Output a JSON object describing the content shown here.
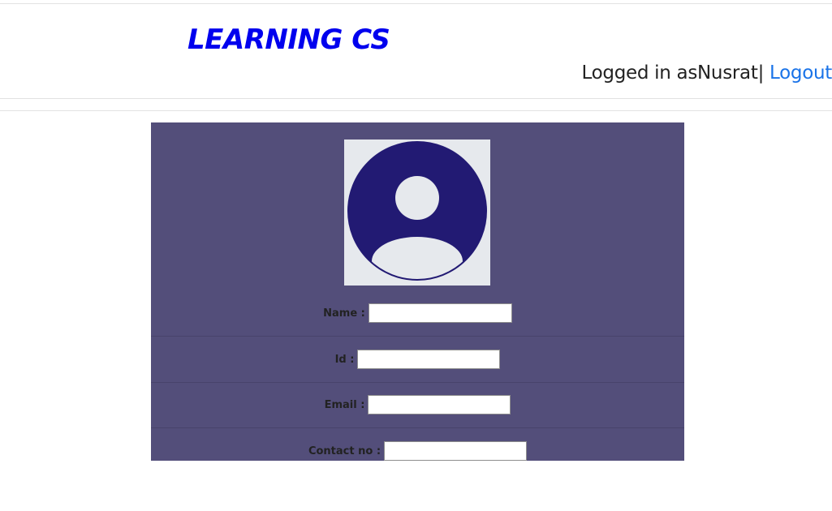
{
  "header": {
    "brand": "LEARNING CS",
    "logged_in_prefix": "Logged in as",
    "username": "Nusrat",
    "separator": "|",
    "logout_label": "Logout"
  },
  "profile": {
    "avatar_icon": "user-avatar-icon",
    "fields": [
      {
        "label": "Name :",
        "value": "",
        "placeholder": ""
      },
      {
        "label": "Id :",
        "value": "",
        "placeholder": ""
      },
      {
        "label": "Email :",
        "value": "",
        "placeholder": ""
      },
      {
        "label": "Contact no :",
        "value": "",
        "placeholder": ""
      }
    ]
  },
  "colors": {
    "brand": "#0000ee",
    "link": "#1a73e8",
    "card_bg": "#534e7a",
    "avatar_circle": "#221a73",
    "avatar_bg": "#e6e9ed"
  }
}
